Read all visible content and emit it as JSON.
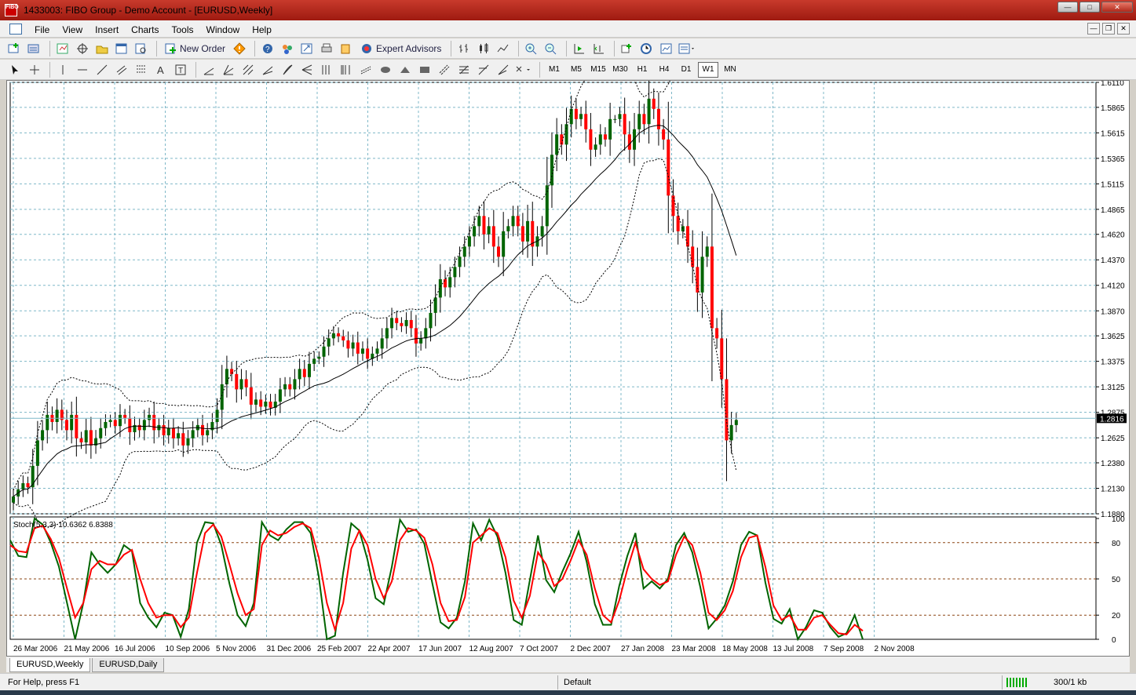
{
  "window": {
    "title": "1433003: FIBO Group - Demo Account - [EURUSD,Weekly]",
    "logo_text": "FIBO"
  },
  "menu": {
    "items": [
      "File",
      "View",
      "Insert",
      "Charts",
      "Tools",
      "Window",
      "Help"
    ]
  },
  "toolbar": {
    "new_order_label": "New Order",
    "expert_advisors_label": "Expert Advisors"
  },
  "timeframes": {
    "items": [
      "M1",
      "M5",
      "M15",
      "M30",
      "H1",
      "H4",
      "D1",
      "W1",
      "MN"
    ],
    "active": "W1"
  },
  "tabs": [
    {
      "label": "EURUSD,Weekly",
      "active": true
    },
    {
      "label": "EURUSD,Daily",
      "active": false
    }
  ],
  "status": {
    "help": "For Help, press F1",
    "profile": "Default",
    "traffic": "300/1 kb"
  },
  "colors": {
    "bull": "#006400",
    "bear": "#ff0000",
    "grid": "#7fb8c8",
    "current_price_line": "#7fb8c8"
  },
  "chart_data": {
    "type": "candlestick",
    "symbol": "EURUSD",
    "period": "Weekly",
    "price_axis": {
      "min": 1.188,
      "max": 1.611,
      "ticks": [
        "1.6110",
        "1.5865",
        "1.5615",
        "1.5365",
        "1.5115",
        "1.4865",
        "1.4620",
        "1.4370",
        "1.4120",
        "1.3870",
        "1.3625",
        "1.3375",
        "1.3125",
        "1.2875",
        "1.2625",
        "1.2380",
        "1.2130",
        "1.1880"
      ]
    },
    "current_price": "1.2816",
    "date_labels": [
      "26 Mar 2006",
      "21 May 2006",
      "16 Jul 2006",
      "10 Sep 2006",
      "5 Nov 2006",
      "31 Dec 2006",
      "25 Feb 2007",
      "22 Apr 2007",
      "17 Jun 2007",
      "12 Aug 2007",
      "7 Oct 2007",
      "2 Dec 2007",
      "27 Jan 2008",
      "23 Mar 2008",
      "18 May 2008",
      "13 Jul 2008",
      "7 Sep 2008",
      "2 Nov 2008"
    ],
    "closes": [
      1.205,
      1.212,
      1.218,
      1.214,
      1.235,
      1.26,
      1.27,
      1.285,
      1.278,
      1.29,
      1.28,
      1.27,
      1.285,
      1.262,
      1.258,
      1.27,
      1.255,
      1.262,
      1.272,
      1.278,
      1.28,
      1.274,
      1.285,
      1.282,
      1.268,
      1.275,
      1.27,
      1.28,
      1.285,
      1.27,
      1.275,
      1.265,
      1.272,
      1.262,
      1.267,
      1.255,
      1.262,
      1.27,
      1.275,
      1.265,
      1.27,
      1.278,
      1.29,
      1.315,
      1.33,
      1.325,
      1.31,
      1.32,
      1.312,
      1.295,
      1.3,
      1.293,
      1.298,
      1.292,
      1.298,
      1.31,
      1.315,
      1.31,
      1.32,
      1.33,
      1.322,
      1.335,
      1.34,
      1.342,
      1.352,
      1.36,
      1.365,
      1.362,
      1.358,
      1.35,
      1.356,
      1.345,
      1.35,
      1.34,
      1.345,
      1.35,
      1.36,
      1.37,
      1.38,
      1.375,
      1.372,
      1.378,
      1.37,
      1.355,
      1.36,
      1.37,
      1.385,
      1.4,
      1.418,
      1.41,
      1.42,
      1.43,
      1.44,
      1.45,
      1.46,
      1.47,
      1.48,
      1.462,
      1.47,
      1.45,
      1.44,
      1.465,
      1.47,
      1.48,
      1.47,
      1.455,
      1.475,
      1.45,
      1.46,
      1.47,
      1.51,
      1.54,
      1.56,
      1.55,
      1.57,
      1.585,
      1.575,
      1.58,
      1.565,
      1.545,
      1.55,
      1.56,
      1.555,
      1.575,
      1.575,
      1.58,
      1.56,
      1.545,
      1.565,
      1.58,
      1.57,
      1.595,
      1.585,
      1.565,
      1.555,
      1.5,
      1.48,
      1.465,
      1.47,
      1.45,
      1.43,
      1.405,
      1.44,
      1.45,
      1.37,
      1.36,
      1.32,
      1.26,
      1.275,
      1.28
    ],
    "indicators": {
      "moving_average": {
        "color": "#000000",
        "style": "solid"
      },
      "bollinger_bands": {
        "color": "#000000",
        "style": "dotted"
      }
    },
    "stochastic": {
      "label": "Stoch(5,3,3) 10.6362 6.8388",
      "range": [
        0,
        100
      ],
      "ticks": [
        "100",
        "80",
        "50",
        "20",
        "0"
      ],
      "levels": [
        80,
        50,
        20
      ],
      "main_color": "#006400",
      "signal_color": "#ff0000",
      "main": [
        82,
        69,
        68,
        100,
        95,
        80,
        60,
        30,
        0,
        30,
        72,
        62,
        55,
        62,
        78,
        73,
        30,
        18,
        10,
        22,
        20,
        2,
        25,
        80,
        97,
        96,
        78,
        46,
        20,
        11,
        30,
        97,
        86,
        82,
        91,
        97,
        97,
        88,
        52,
        0,
        3,
        55,
        96,
        90,
        66,
        34,
        29,
        60,
        99,
        89,
        91,
        79,
        46,
        14,
        9,
        18,
        48,
        96,
        82,
        99,
        85,
        55,
        16,
        12,
        49,
        86,
        49,
        39,
        56,
        71,
        89,
        64,
        29,
        12,
        12,
        44,
        69,
        88,
        42,
        48,
        42,
        50,
        78,
        88,
        72,
        43,
        9,
        17,
        28,
        48,
        78,
        89,
        86,
        47,
        17,
        13,
        25,
        0,
        10,
        24,
        22,
        10,
        2,
        5,
        20,
        0
      ],
      "signal": [
        78,
        73,
        72,
        92,
        94,
        83,
        67,
        42,
        18,
        30,
        58,
        65,
        62,
        62,
        70,
        74,
        50,
        30,
        18,
        20,
        20,
        10,
        18,
        55,
        88,
        95,
        85,
        62,
        38,
        20,
        25,
        78,
        90,
        86,
        88,
        93,
        96,
        92,
        68,
        30,
        8,
        30,
        75,
        90,
        78,
        50,
        34,
        48,
        82,
        92,
        90,
        84,
        62,
        30,
        15,
        16,
        35,
        80,
        86,
        92,
        88,
        68,
        32,
        18,
        36,
        72,
        62,
        44,
        50,
        65,
        82,
        70,
        42,
        20,
        14,
        32,
        58,
        80,
        58,
        50,
        45,
        48,
        70,
        85,
        78,
        55,
        22,
        16,
        24,
        40,
        68,
        84,
        86,
        60,
        28,
        16,
        20,
        8,
        8,
        18,
        20,
        12,
        5,
        4,
        12,
        7
      ]
    }
  }
}
